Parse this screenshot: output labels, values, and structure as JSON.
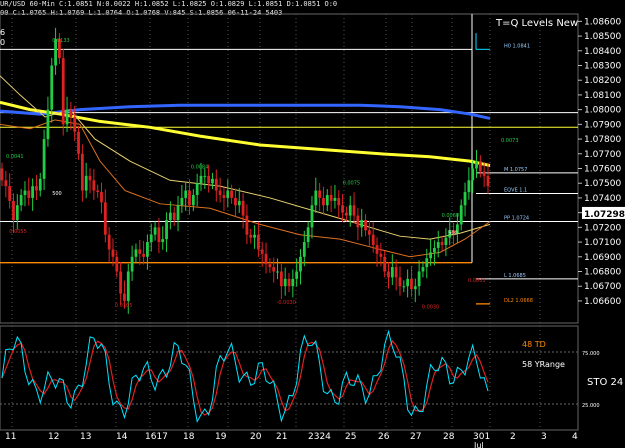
{
  "header": {
    "line1": "UR/USD 60-Min  C:1.0851  N:0.0022  H:1.0852  L:1.0825  O:1.0829  L:1.0851  D:1.0851  O:0",
    "line2": "00  C:1.0765  H:1.0769  L:1.0764  O:1.0768  V:845  S:1.0856  06-11-24  5403",
    "frag_top": "6",
    "frag_bottom": "0"
  },
  "study_title": "T=Q Levels New",
  "indicator": {
    "label_td": "48 TD",
    "label_yrange": "58 YRange",
    "label_sto": "STO  24",
    "ticks": [
      "75.000",
      "25.000"
    ]
  },
  "colors": {
    "background": "#000000",
    "candle_up": "#22cc44",
    "candle_down": "#dd2222",
    "ma_yellow": "#ffff33",
    "ma_blue": "#3366ff",
    "ma_tan": "#e8d070",
    "ma_orange": "#e07020",
    "level_orange": "#ff8800",
    "level_white": "#ffffff",
    "cyan": "#00e0ff",
    "sto_fast": "#00e5ff",
    "sto_slow": "#dd2222"
  },
  "chart_data": {
    "type": "candlestick",
    "title": "T=Q Levels New",
    "symbol": "EUR/USD",
    "interval": "60-Min",
    "ylim": [
      1.0655,
      1.0865
    ],
    "y_ticks": [
      1.086,
      1.085,
      1.084,
      1.083,
      1.082,
      1.081,
      1.08,
      1.079,
      1.078,
      1.077,
      1.076,
      1.075,
      1.074,
      1.073,
      1.072,
      1.071,
      1.07,
      1.069,
      1.068,
      1.067
    ],
    "y_tick_labels": [
      "1.08600",
      "1.08500",
      "1.08400",
      "1.08300",
      "1.08200",
      "1.08100",
      "1.08000",
      "1.07900",
      "1.07800",
      "1.07700",
      "1.07600",
      "1.07500",
      "1.07400",
      "1.07298",
      "1.07200",
      "1.07100",
      "1.06900",
      "1.06800",
      "1.06700",
      "1.06600"
    ],
    "last_price_label": "1.07298",
    "x_tick_labels": [
      "11",
      "12",
      "13",
      "14",
      "1617",
      "18",
      "19",
      "20",
      "21",
      "2324",
      "25",
      "26",
      "27",
      "28",
      "301",
      "2",
      "3",
      "4"
    ],
    "x_tick_header": "Jul",
    "levels": [
      {
        "name": "H",
        "value": 1.0841,
        "color": "#ffffff",
        "label": "H0  1.0841"
      },
      {
        "name": "R",
        "value": 1.0798,
        "color": "#ffffff",
        "label": "1.07980"
      },
      {
        "name": "R2",
        "value": 1.0788,
        "color": "#ffff33",
        "label": ""
      },
      {
        "name": "MID",
        "value": 1.0757,
        "color": "#ffffff",
        "label": "M  1.0757"
      },
      {
        "name": "EQ",
        "value": 1.0743,
        "color": "#ffffff",
        "label": "EQVE  1.1"
      },
      {
        "name": "PP",
        "value": 1.0724,
        "color": "#ffffff",
        "label": "PP  1.0724"
      },
      {
        "name": "L",
        "value": 1.0696,
        "color": "#ff8800",
        "label": ""
      },
      {
        "name": "L1",
        "value": 1.0685,
        "color": "#ffffff",
        "label": "L  1.0685"
      },
      {
        "name": "DL",
        "value": 1.0668,
        "color": "#ff8800",
        "label": "DL2  1.0668"
      }
    ],
    "inline_labels": [
      {
        "text": "0.0133",
        "x": 14,
        "y": 1.0846,
        "color": "#22cc44"
      },
      {
        "text": "0.0041",
        "x": 0,
        "y": 1.0767,
        "color": "#22cc44"
      },
      {
        "text": "0.0084",
        "x": 56,
        "y": 1.076,
        "color": "#22cc44"
      },
      {
        "text": "0.0075",
        "x": 102,
        "y": 1.0749,
        "color": "#22cc44"
      },
      {
        "text": "0.0055",
        "x": 1,
        "y": 1.0716,
        "color": "#dd2222"
      },
      {
        "text": "0.0105",
        "x": 33,
        "y": 1.0666,
        "color": "#dd2222"
      },
      {
        "text": "-0.0030",
        "x": 82,
        "y": 1.0668,
        "color": "#dd2222"
      },
      {
        "text": "0.0030",
        "x": 126,
        "y": 1.0665,
        "color": "#dd2222"
      },
      {
        "text": "0.0031",
        "x": 140,
        "y": 1.0683,
        "color": "#dd2222"
      },
      {
        "text": "0.0060",
        "x": 132,
        "y": 1.0727,
        "color": "#22cc44"
      },
      {
        "text": "0.0073",
        "x": 150,
        "y": 1.0778,
        "color": "#22cc44"
      },
      {
        "text": "500",
        "x": 14,
        "y": 1.0742,
        "color": "#ffffff"
      },
      {
        "text": "500",
        "x": 134,
        "y": 1.0715,
        "color": "#ffffff"
      }
    ],
    "series": [
      {
        "name": "Price",
        "type": "candlestick",
        "values_close": [
          1.0752,
          1.0748,
          1.0738,
          1.0725,
          1.0735,
          1.0742,
          1.0745,
          1.074,
          1.0748,
          1.0745,
          1.0753,
          1.078,
          1.08,
          1.083,
          1.0848,
          1.0835,
          1.079,
          1.08,
          1.0795,
          1.0785,
          1.077,
          1.0745,
          1.0755,
          1.0752,
          1.0745,
          1.0744,
          1.0737,
          1.0715,
          1.0705,
          1.07,
          1.069,
          1.0675,
          1.067,
          1.069,
          1.07,
          1.0705,
          1.0702,
          1.07,
          1.071,
          1.0715,
          1.072,
          1.071,
          1.0712,
          1.0725,
          1.073,
          1.0725,
          1.0735,
          1.074,
          1.0745,
          1.0735,
          1.0742,
          1.075,
          1.0755,
          1.0755,
          1.075,
          1.0753,
          1.0745,
          1.0742,
          1.074,
          1.0745,
          1.074,
          1.0735,
          1.0738,
          1.0728,
          1.0715,
          1.0713,
          1.0715,
          1.0705,
          1.0702,
          1.0695,
          1.0693,
          1.069,
          1.069,
          1.068,
          1.0685,
          1.068,
          1.0685,
          1.069,
          1.07,
          1.071,
          1.072,
          1.0735,
          1.0745,
          1.074,
          1.0735,
          1.0742,
          1.0738,
          1.074,
          1.0735,
          1.073,
          1.0728,
          1.0735,
          1.0728,
          1.072,
          1.0725,
          1.0718,
          1.0715,
          1.0708,
          1.0702,
          1.07,
          1.069,
          1.0686,
          1.0693,
          1.0686,
          1.068,
          1.068,
          1.0685,
          1.0678,
          1.068,
          1.069,
          1.0693,
          1.0699,
          1.0703,
          1.0706,
          1.071,
          1.0708,
          1.0713,
          1.0718,
          1.0716,
          1.0722,
          1.0735,
          1.0744,
          1.0752,
          1.076,
          1.0765,
          1.0758,
          1.0755,
          1.0748
        ]
      }
    ]
  }
}
